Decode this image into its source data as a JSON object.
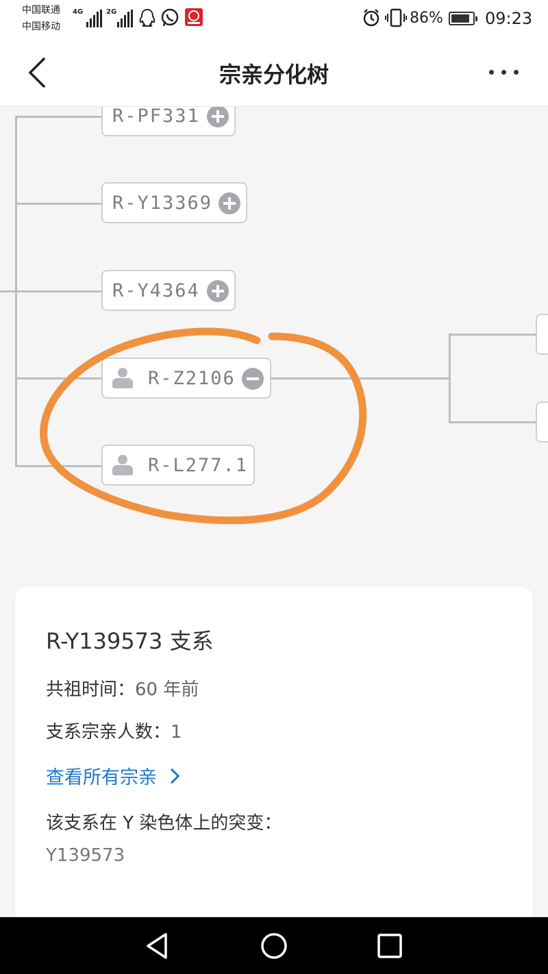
{
  "status_bar": {
    "carrier_1": "中国联通",
    "carrier_2": "中国移动",
    "net_1": "4G",
    "net_2": "2G",
    "battery_percent": "86%",
    "battery_level": 0.86,
    "time": "09:23",
    "icons": [
      "signal-icon",
      "qq-icon",
      "whatsapp-icon",
      "app-badge-icon",
      "alarm-icon",
      "vibrate-icon",
      "battery-icon"
    ]
  },
  "header": {
    "title": "宗亲分化树",
    "back_icon": "chevron-left-icon",
    "more_icon": "more-dots-icon"
  },
  "tree": {
    "nodes": [
      {
        "label": "R-PF331",
        "toggle": "plus",
        "has_person": false
      },
      {
        "label": "R-Y13369",
        "toggle": "plus",
        "has_person": false
      },
      {
        "label": "R-Y4364",
        "toggle": "plus",
        "has_person": false
      },
      {
        "label": "R-Z2106",
        "toggle": "minus",
        "has_person": true
      },
      {
        "label": "R-L277.1",
        "toggle": "none",
        "has_person": true
      }
    ],
    "annotation_color": "#f0913f"
  },
  "card": {
    "title": "R-Y139573 支系",
    "ancestor_label": "共祖时间：",
    "ancestor_value": "60 年前",
    "count_label": "支系宗亲人数：",
    "count_value": "1",
    "view_all_link": "查看所有宗亲",
    "mutation_label": "该支系在 Y 染色体上的突变：",
    "mutation_value": "Y139573"
  },
  "nav": {
    "back_icon": "nav-back-triangle-icon",
    "home_icon": "nav-home-circle-icon",
    "recent_icon": "nav-recent-square-icon"
  },
  "colors": {
    "link": "#1f7ac9",
    "annotation": "#f0913f",
    "tree_line": "#bdbdc6"
  }
}
